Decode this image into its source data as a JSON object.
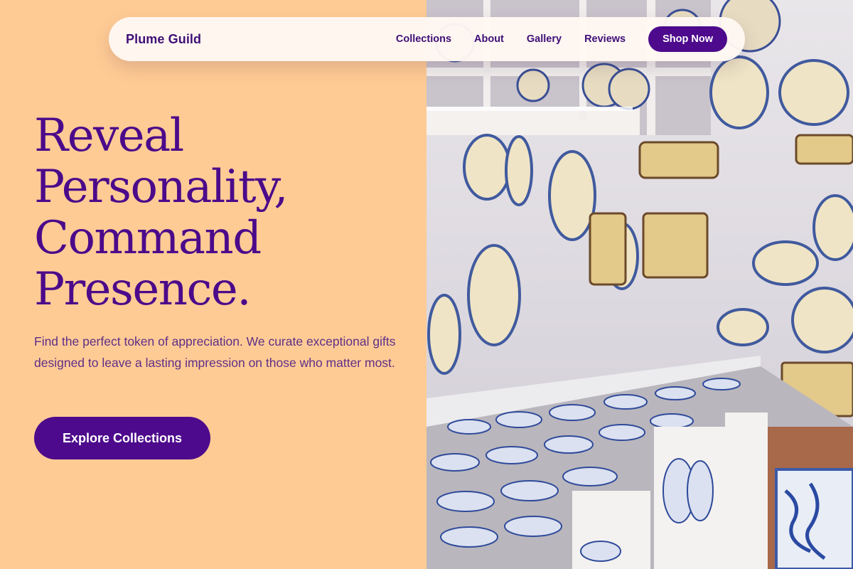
{
  "nav": {
    "brand": "Plume Guild",
    "links": [
      "Collections",
      "About",
      "Gallery",
      "Reviews"
    ],
    "cta_label": "Shop Now"
  },
  "hero": {
    "title_lines": [
      "Reveal",
      "Personality,",
      "Command",
      "Presence."
    ],
    "subtitle": "Find the perfect token of appreciation. We curate exceptional gifts designed to leave a lasting impression on those who matter most.",
    "cta_label": "Explore Collections"
  },
  "photo": {
    "subject": "ceramics shop display"
  },
  "colors": {
    "background": "#ffcb95",
    "accent": "#4d0a8c",
    "title_text": "#4b0a8a",
    "body_text": "#5e2f86",
    "nav_bg": "#fff8f2"
  }
}
